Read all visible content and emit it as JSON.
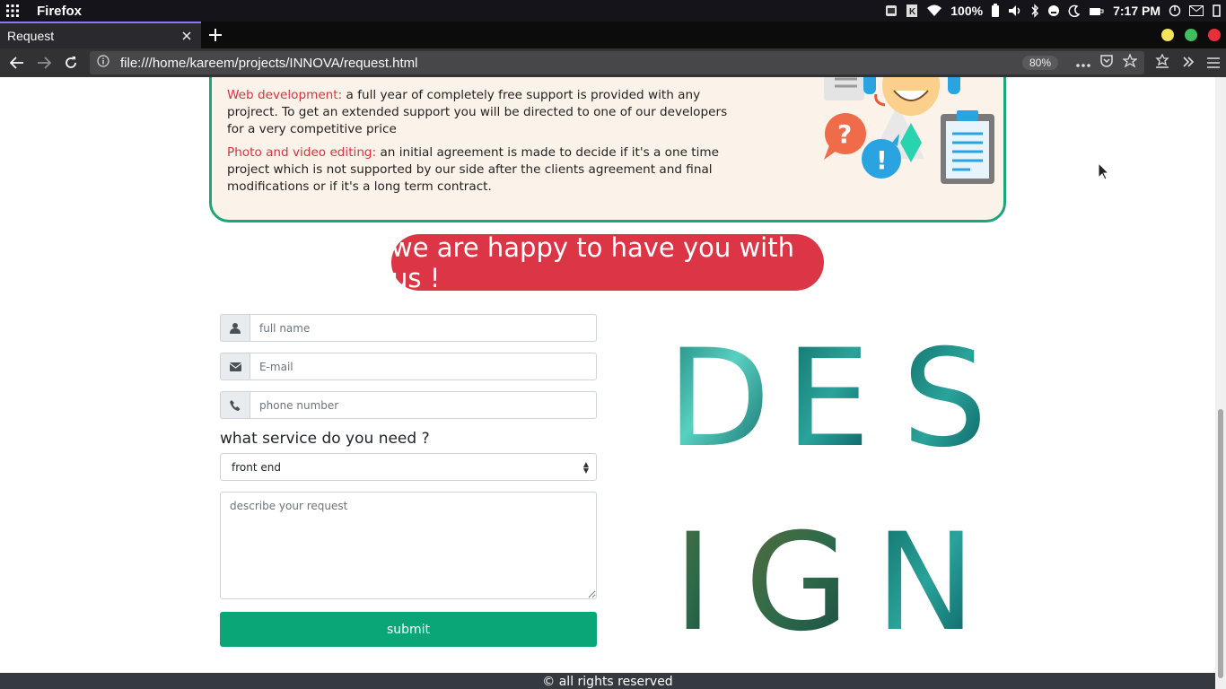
{
  "os_bar": {
    "app_name": "Firefox",
    "battery": "100%",
    "time": "7:17 PM"
  },
  "browser": {
    "tab_title": "Request",
    "url": "file:///home/kareem/projects/INNOVA/request.html",
    "zoom": "80%",
    "window_controls": {
      "minimize_color": "#f2e55c",
      "maximize_color": "#3fbf5f",
      "close_color": "#e8303a"
    }
  },
  "page": {
    "info": {
      "web_dev_title": "Web development:",
      "web_dev_text": " a full year of completely free support is provided with any projrect. To get an extended support you will be directed to one of our developers for a very competitive price",
      "photo_title": "Photo and video editing:",
      "photo_text": " an initial agreement is made to decide if it's a one time project which is not supported by our side after the clients agreement and final modifications or if it's a long term contract."
    },
    "happy_banner": "we are happy to have you with us !",
    "form": {
      "name_placeholder": "full name",
      "email_placeholder": "E-mail",
      "phone_placeholder": "phone number",
      "service_label": "what service do you need ?",
      "service_selected": "front end",
      "request_placeholder": "describe your request",
      "submit_label": "submit"
    },
    "design_letters": {
      "row1": [
        "D",
        "E",
        "S"
      ],
      "row2": [
        "I",
        "G",
        "N"
      ]
    },
    "footer": "© all rights reserved"
  },
  "colors": {
    "accent_red": "#dc3545",
    "accent_green": "#0aa678",
    "info_border": "#1ba57b",
    "footer_bg": "#343a40"
  },
  "icons": [
    "apps-grid-icon",
    "user-icon",
    "envelope-icon",
    "phone-icon",
    "reload-icon",
    "back-icon",
    "forward-icon",
    "pocket-icon",
    "bookmark-star-icon",
    "menu-icon",
    "support-illustration"
  ]
}
